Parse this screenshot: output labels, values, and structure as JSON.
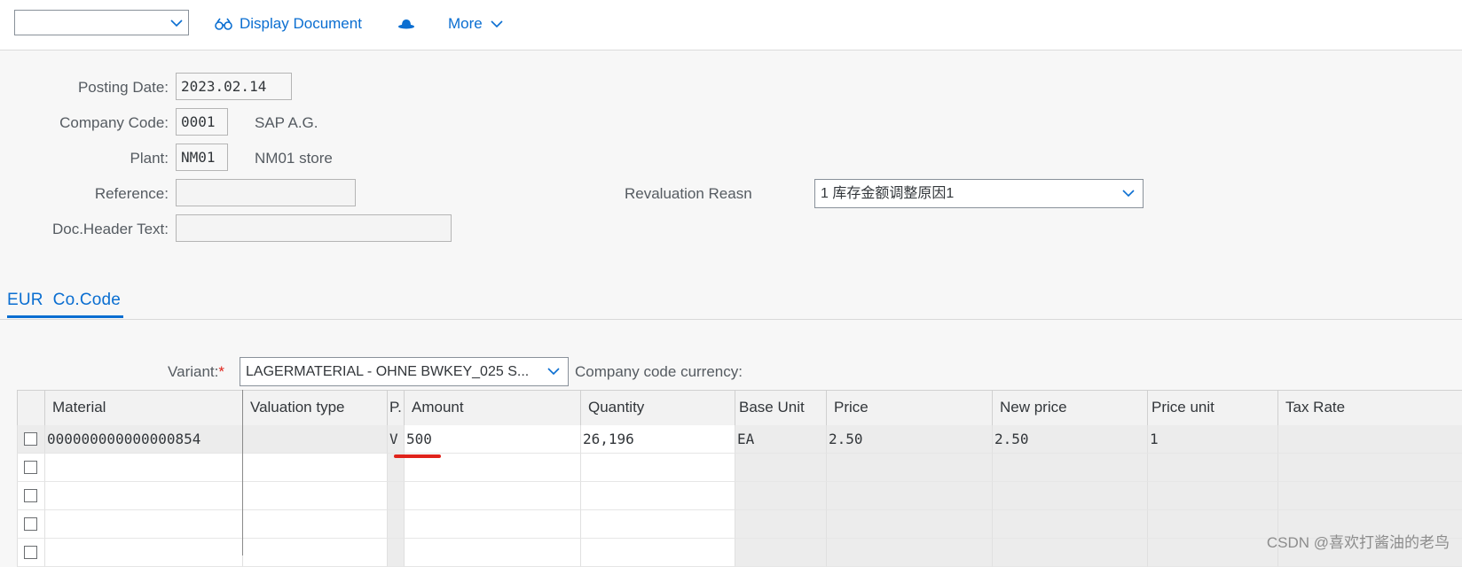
{
  "toolbar": {
    "select_value": "",
    "display_document_label": "Display Document",
    "more_label": "More"
  },
  "form": {
    "posting_date_label": "Posting Date:",
    "posting_date_value": "2023.02.14",
    "company_code_label": "Company Code:",
    "company_code_value": "0001",
    "company_code_desc": "SAP A.G.",
    "plant_label": "Plant:",
    "plant_value": "NM01",
    "plant_desc": "NM01 store",
    "reference_label": "Reference:",
    "reference_value": "",
    "doc_header_label": "Doc.Header Text:",
    "doc_header_value": "",
    "revaluation_label": "Revaluation Reasn",
    "revaluation_value": "1 库存金额调整原因1"
  },
  "tabs": [
    {
      "label": "EUR  Co.Code"
    }
  ],
  "variant": {
    "label": "Variant:",
    "required_mark": "*",
    "value": "LAGERMATERIAL - OHNE BWKEY_025 S...",
    "currency_label": "Company code currency:"
  },
  "table": {
    "columns": [
      "Material",
      "Valuation type",
      "P.",
      "Amount",
      "Quantity",
      "Base Unit",
      "Price",
      "New price",
      "Price unit",
      "Tax Rate"
    ],
    "rows": [
      [
        "000000000000000854",
        "",
        "V",
        "500",
        "26,196",
        "EA",
        "2.50",
        "2.50",
        "1",
        ""
      ],
      [
        "",
        "",
        "",
        "",
        "",
        "",
        "",
        "",
        "",
        ""
      ],
      [
        "",
        "",
        "",
        "",
        "",
        "",
        "",
        "",
        "",
        ""
      ],
      [
        "",
        "",
        "",
        "",
        "",
        "",
        "",
        "",
        "",
        ""
      ],
      [
        "",
        "",
        "",
        "",
        "",
        "",
        "",
        "",
        "",
        ""
      ]
    ]
  },
  "watermark": "CSDN @喜欢打酱油的老鸟",
  "colors": {
    "accent": "#0a6ed1",
    "highlight": "#e0231b"
  }
}
